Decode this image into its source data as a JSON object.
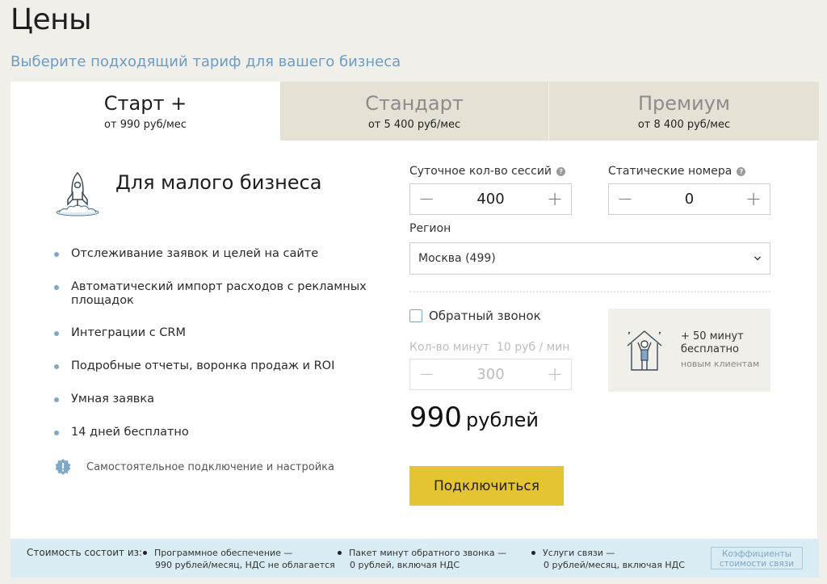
{
  "page": {
    "title": "Цены",
    "subtitle": "Выберите подходящий тариф для вашего бизнеса"
  },
  "tabs": [
    {
      "name": "Старт +",
      "price": "от 990 руб/мес",
      "active": true
    },
    {
      "name": "Стандарт",
      "price": "от 5 400 руб/мес",
      "active": false
    },
    {
      "name": "Премиум",
      "price": "от 8 400 руб/мес",
      "active": false
    }
  ],
  "plan": {
    "heading": "Для малого бизнеса",
    "icon": "rocket-icon",
    "features": [
      "Отслеживание заявок и целей на сайте",
      "Автоматический импорт расходов с рекламных площадок",
      "Интеграции с CRM",
      "Подробные отчеты, воронка продаж и ROI",
      "Умная заявка",
      "14 дней бесплатно"
    ],
    "self_setup": "Самостоятельное подключение и настройка"
  },
  "config": {
    "sessions_label": "Суточное кол-во сессий",
    "sessions_value": "400",
    "static_numbers_label": "Статические номера",
    "static_numbers_value": "0",
    "minus": "−",
    "plus": "+",
    "help": "?",
    "region_label": "Регион",
    "region_value": "Москва (499)",
    "callback_label": "Обратный звонок",
    "callback_checked": false,
    "minutes_label": "Кол-во минут  10 руб / мин",
    "minutes_value": "300",
    "price_number": "990",
    "price_unit": "рублей",
    "connect_button": "Подключиться"
  },
  "promo": {
    "line1": "+ 50 минут",
    "line2": "бесплатно",
    "line3": "новым клиентам"
  },
  "footer": {
    "lead": "Стоимость состоит из:",
    "items": [
      {
        "line1": "Программное обеспечение —",
        "line2": "990 рублей/месяц, НДС не облагается"
      },
      {
        "line1": "Пакет минут обратного звонка —",
        "line2": "0 рублей, включая НДС"
      },
      {
        "line1": "Услуги связи —",
        "line2": "0 рублей/месяц, включая НДС"
      }
    ],
    "coef_button_line1": "Коэффициенты",
    "coef_button_line2": "стоимости связи"
  },
  "colors": {
    "background": "#f0efea",
    "accent_blue": "#7fa7c8",
    "tab_inactive": "#e5e1d5",
    "button_yellow": "#e4c531",
    "footer_bg": "#d9ecf3"
  }
}
